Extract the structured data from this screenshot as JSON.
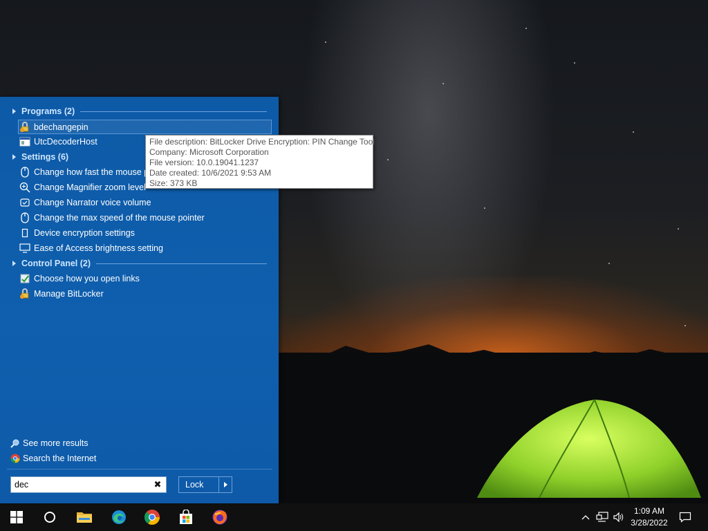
{
  "start_menu": {
    "groups": {
      "programs": {
        "label": "Programs (2)",
        "items": [
          {
            "label": "bdechangepin",
            "icon": "bitlocker-icon"
          },
          {
            "label": "UtcDecoderHost",
            "icon": "window-icon"
          }
        ]
      },
      "settings": {
        "label": "Settings (6)",
        "items": [
          {
            "label": "Change how fast the mouse po",
            "icon": "mouse-icon"
          },
          {
            "label": "Change Magnifier zoom level",
            "icon": "magnifier-icon"
          },
          {
            "label": "Change Narrator voice volume",
            "icon": "narrator-icon"
          },
          {
            "label": "Change the max speed of the mouse pointer",
            "icon": "mouse-icon"
          },
          {
            "label": "Device encryption settings",
            "icon": "device-icon"
          },
          {
            "label": "Ease of Access brightness setting",
            "icon": "monitor-icon"
          }
        ]
      },
      "control_panel": {
        "label": "Control Panel (2)",
        "items": [
          {
            "label": "Choose how you open links",
            "icon": "default-programs-icon"
          },
          {
            "label": "Manage BitLocker",
            "icon": "bitlocker-icon"
          }
        ]
      }
    },
    "see_more": "See more results",
    "search_internet": "Search the Internet",
    "search_value": "dec",
    "clear_glyph": "✖",
    "power_button": "Lock"
  },
  "tooltip": {
    "lines": [
      "File description: BitLocker Drive Encryption: PIN Change Tool",
      "Company: Microsoft Corporation",
      "File version: 10.0.19041.1237",
      "Date created: 10/6/2021 9:53 AM",
      "Size: 373 KB"
    ]
  },
  "taskbar": {
    "pinned": [
      "windows-start-icon",
      "cortana-circle-icon",
      "file-explorer-icon",
      "edge-icon",
      "chrome-icon",
      "store-icon",
      "firefox-icon"
    ],
    "clock": {
      "time": "1:09 AM",
      "date": "3/28/2022"
    }
  },
  "colors": {
    "menu_bg": "#0f5fae",
    "header_text": "#cfe6ff",
    "taskbar_bg": "#101010"
  }
}
